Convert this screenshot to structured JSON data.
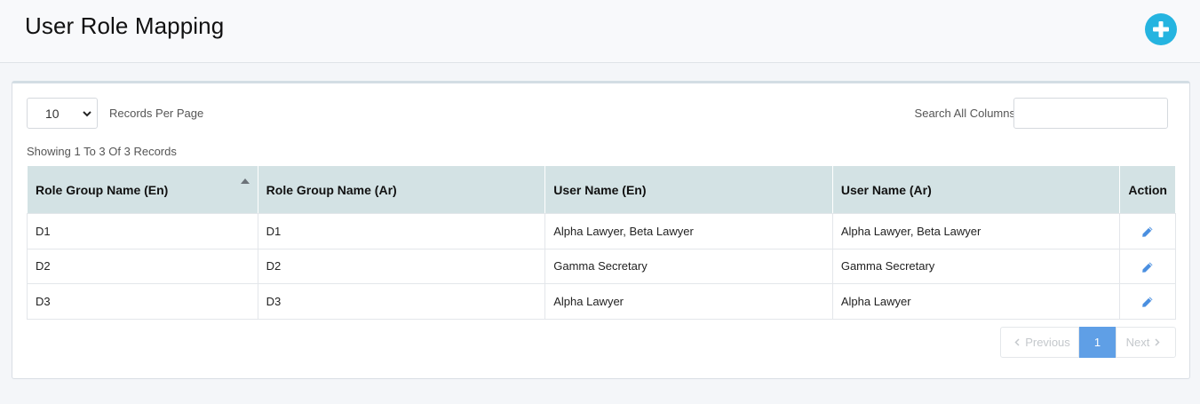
{
  "header": {
    "title": "User Role Mapping",
    "add_icon": "plus-icon",
    "accent_color": "#25b4e0"
  },
  "controls": {
    "per_page_value": "10",
    "per_page_label": "Records Per Page",
    "search_label": "Search All Columns",
    "search_value": ""
  },
  "summary": "Showing 1 To 3 Of 3 Records",
  "table": {
    "header_color": "#d3e2e4",
    "columns": [
      "Role Group Name (En)",
      "Role Group Name (Ar)",
      "User Name (En)",
      "User Name (Ar)",
      "Action"
    ],
    "sorted_column": "Role Group Name (En)",
    "sort_direction": "ascending",
    "rows": [
      [
        "D1",
        "D1",
        "Alpha Lawyer, Beta Lawyer",
        "Alpha Lawyer, Beta Lawyer"
      ],
      [
        "D2",
        "D2",
        "Gamma Secretary",
        "Gamma Secretary"
      ],
      [
        "D3",
        "D3",
        "Alpha Lawyer",
        "Alpha Lawyer"
      ]
    ],
    "action_icon": "pencil-icon"
  },
  "pagination": {
    "previous": "Previous",
    "current": "1",
    "next": "Next",
    "active_color": "#5f9fe6"
  }
}
